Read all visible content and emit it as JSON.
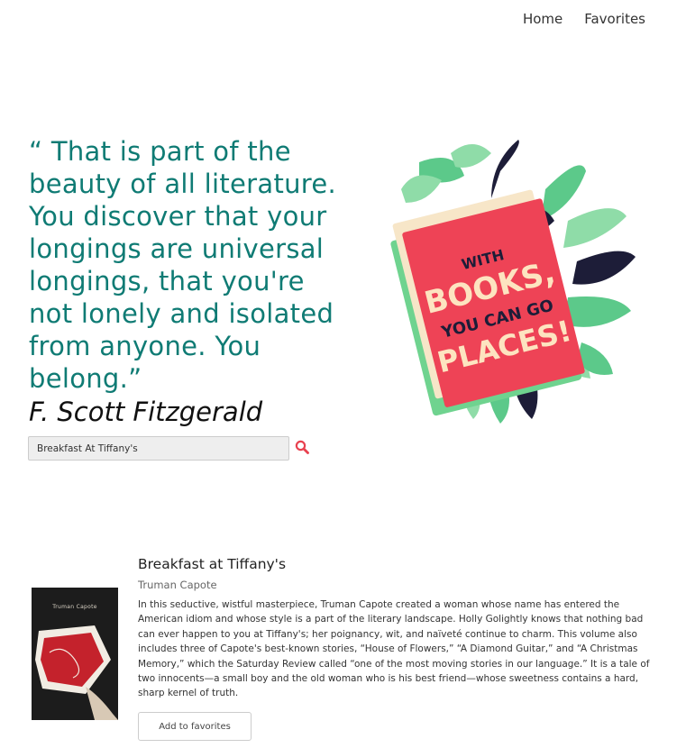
{
  "nav": {
    "home": "Home",
    "favorites": "Favorites"
  },
  "hero": {
    "quote": "“ That is part of the beauty of all literature. You discover that your longings are universal longings, that you're not lonely and isolated from anyone. You belong.”",
    "author": "F. Scott Fitzgerald",
    "illustration_text": "WITH BOOKS, YOU CAN GO PLACES!"
  },
  "search": {
    "value": "Breakfast At Tiffany's",
    "icon": "search-icon"
  },
  "result": {
    "title": "Breakfast at Tiffany's",
    "author": "Truman Capote",
    "cover_author": "Truman Capote",
    "description": "In this seductive, wistful masterpiece, Truman Capote created a woman whose name has entered the American idiom and whose style is a part of the literary landscape. Holly Golightly knows that nothing bad can ever happen to you at Tiffany's; her poignancy, wit, and naïveté continue to charm. This volume also includes three of Capote's best-known stories, “House of Flowers,” “A Diamond Guitar,” and “A Christmas Memory,” which the Saturday Review called “one of the most moving stories in our language.” It is a tale of two innocents—a small boy and the old woman who is his best friend—whose sweetness contains a hard, sharp kernel of truth.",
    "add_button": "Add to favorites"
  },
  "colors": {
    "quote_teal": "#0f7b74",
    "accent_red": "#e8414f",
    "leaf_green": "#5cc98a",
    "leaf_dark": "#1d1d38"
  }
}
